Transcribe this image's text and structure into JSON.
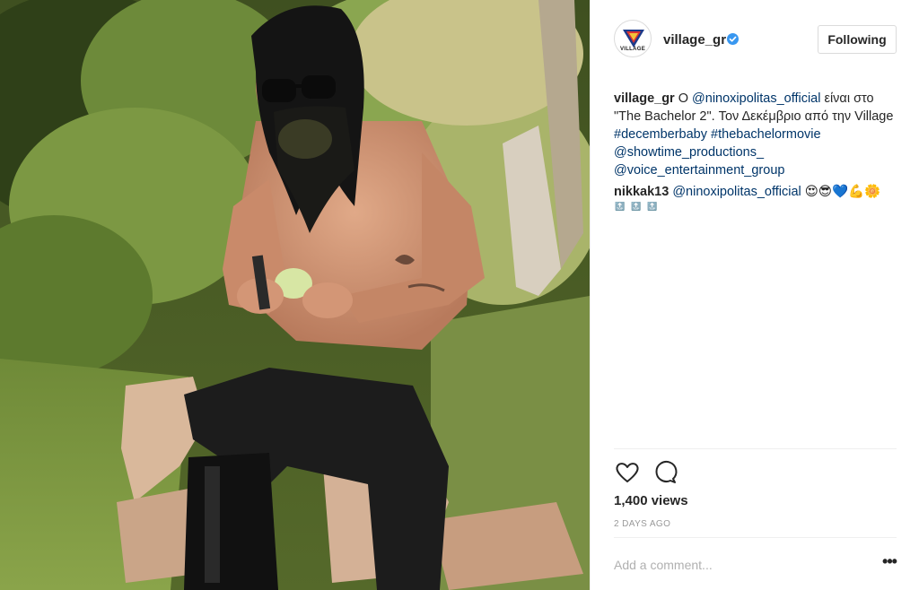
{
  "post": {
    "author": {
      "username": "village_gr",
      "avatar_text": "VILLAGE",
      "verified": true,
      "follow_label": "Following"
    },
    "caption": {
      "username": "village_gr",
      "segments": [
        {
          "text": "Ο ",
          "link": false
        },
        {
          "text": "@ninoxipolitas_official",
          "link": true
        },
        {
          "text": " είναι στο \"The Bachelor 2\". Τον Δεκέμβριο από την Village ",
          "link": false
        },
        {
          "text": "#decemberbaby",
          "link": true
        },
        {
          "text": " ",
          "link": false
        },
        {
          "text": "#thebachelormovie",
          "link": true
        },
        {
          "text": " ",
          "link": false
        },
        {
          "text": "@showtime_productions_",
          "link": true
        },
        {
          "text": " ",
          "link": false
        },
        {
          "text": "@voice_entertainment_group",
          "link": true
        }
      ]
    },
    "comments": [
      {
        "username": "nikkak13",
        "mention": "@ninoxipolitas_official",
        "emojis": "😍😎💙💪🌼",
        "badges": [
          "TOP",
          "TOP",
          "TOP"
        ]
      }
    ],
    "actions": {
      "like_icon": "heart-icon",
      "comment_icon": "comment-bubble-icon"
    },
    "views": "1,400 views",
    "time": "2 DAYS AGO",
    "comment_placeholder": "Add a comment...",
    "more_label": "•••"
  },
  "colors": {
    "link": "#003569",
    "text": "#262626",
    "muted": "#999999",
    "verified": "#3897f0",
    "border": "#dbdbdb"
  }
}
